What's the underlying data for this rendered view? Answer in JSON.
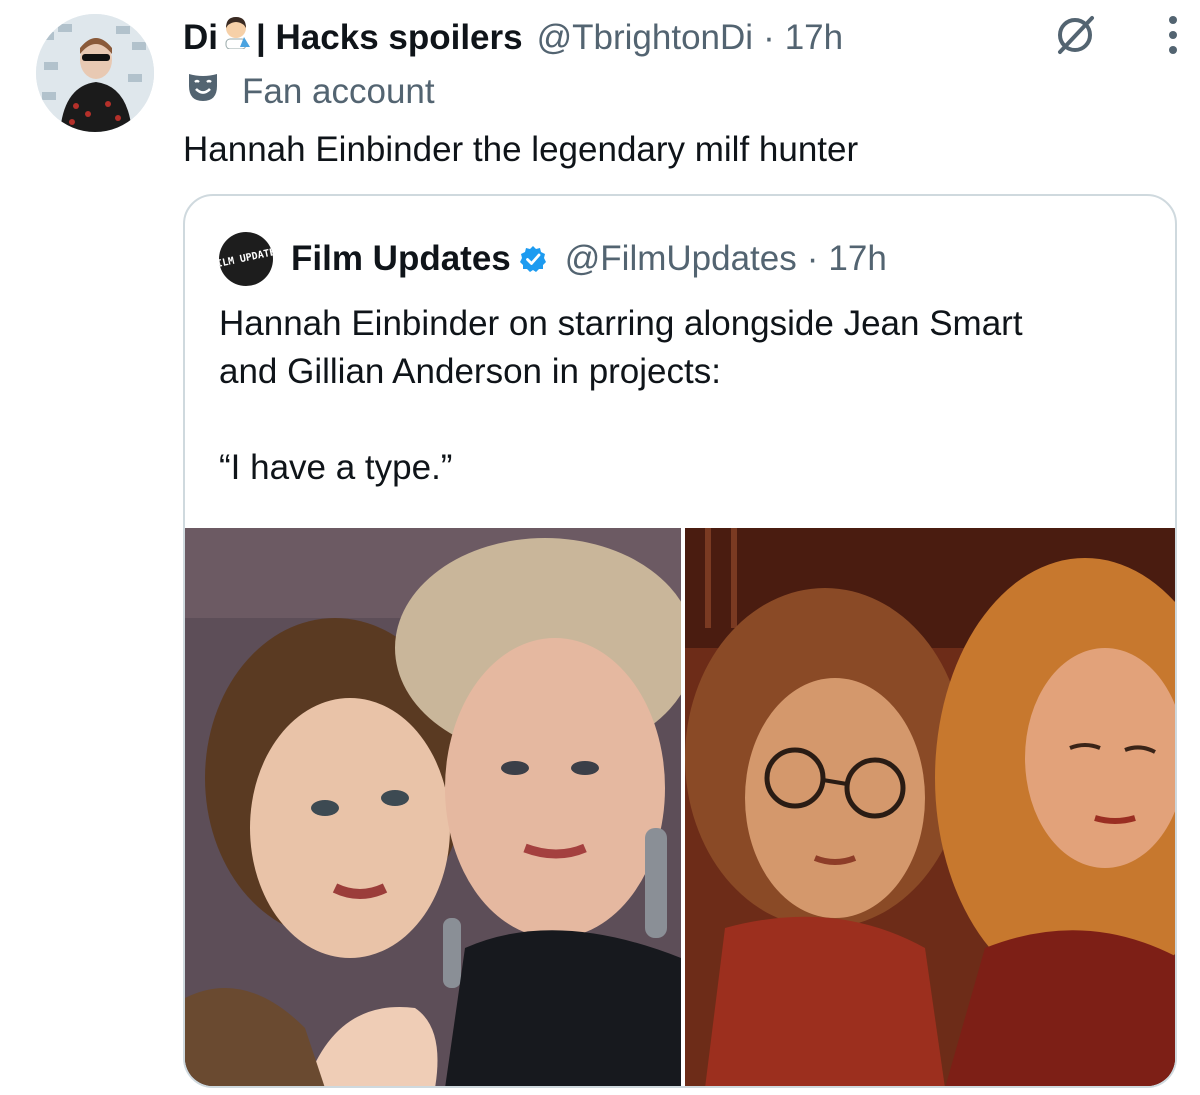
{
  "tweet": {
    "display_name": "Di",
    "display_name_suffix": "| Hacks spoilers",
    "handle": "@TbrightonDi",
    "separator": "·",
    "time": "17h",
    "label": "Fan account",
    "text": "Hannah Einbinder the legendary milf hunter"
  },
  "quoted_tweet": {
    "avatar_text": "FILM UPDATES",
    "display_name": "Film Updates",
    "handle": "@FilmUpdates",
    "separator": "·",
    "time": "17h",
    "text": "Hannah Einbinder on starring alongside Jean Smart\nand Gillian Anderson in projects:\n\n“I have a type.”"
  },
  "icons": {
    "grok": "grok-icon",
    "more": "more-icon",
    "label": "theater-mask-icon",
    "verified": "verified-badge-icon"
  },
  "colors": {
    "text": "#0f1419",
    "secondary": "#536471",
    "verified": "#1d9bf0",
    "border": "#cfd9de"
  }
}
